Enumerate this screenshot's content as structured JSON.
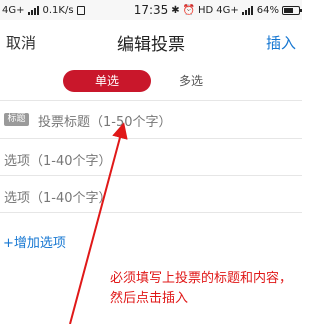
{
  "status_bar": {
    "network_left": "4G+",
    "speed": "0.1K/s",
    "time": "17:35",
    "hd": "HD",
    "network_right": "4G+",
    "battery": "64%"
  },
  "nav": {
    "cancel_label": "取消",
    "title": "编辑投票",
    "insert_label": "插入"
  },
  "tabs": {
    "single_label": "单选",
    "multi_label": "多选",
    "active": "single"
  },
  "form": {
    "title_badge": "标题",
    "title_placeholder": "投票标题（1-50个字）",
    "option_placeholders": [
      "选项（1-40个字）",
      "选项（1-40个字）"
    ],
    "add_option_label": "+增加选项"
  },
  "annotation": {
    "text": "必须填写上投票的标题和内容，然后点击插入"
  },
  "colors": {
    "accent_red": "#c9172b",
    "link_blue": "#1677d2",
    "annotation_red": "#e01818"
  },
  "icons": [
    "signal-icon",
    "wifi-icon",
    "battery-icon",
    "bluetooth-icon",
    "alarm-icon",
    "sim-icon"
  ]
}
